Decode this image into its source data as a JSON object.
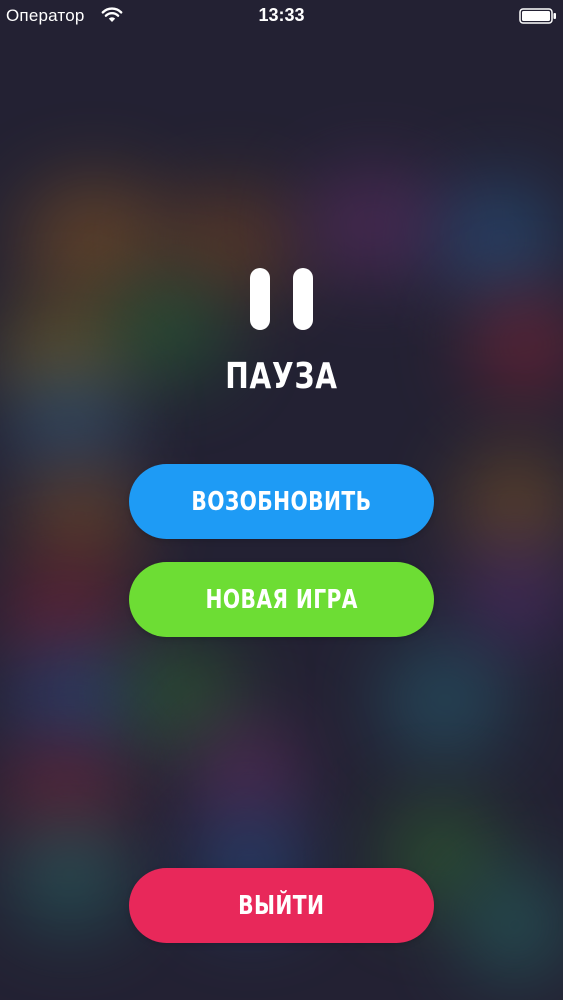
{
  "status_bar": {
    "carrier": "Оператор",
    "time": "13:33",
    "icons": [
      "wifi-icon",
      "battery-icon"
    ]
  },
  "pause": {
    "icon": "pause-icon",
    "title": "ПАУЗА"
  },
  "buttons": {
    "resume": "ВОЗОБНОВИТЬ",
    "new_game": "НОВАЯ ИГРА",
    "exit": "ВЫЙТИ"
  },
  "colors": {
    "background": "#272638",
    "resume_button": "#1e9bf5",
    "new_game_button": "#6ddd34",
    "exit_button": "#e8285a",
    "text": "#ffffff"
  }
}
